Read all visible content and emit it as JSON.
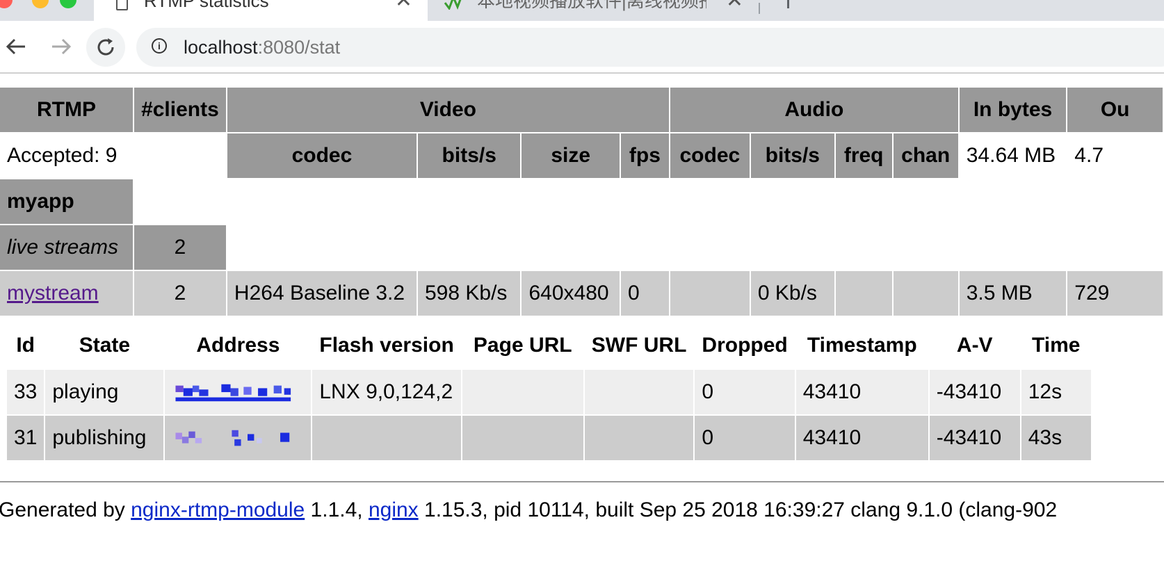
{
  "browser": {
    "active_tab_title": "RTMP statistics",
    "inactive_tab_title": "本地视频播放软件|离线视频播放",
    "url_host": "localhost",
    "url_rest": ":8080/stat"
  },
  "stat_table": {
    "headers": {
      "rtmp": "RTMP",
      "clients": "#clients",
      "video": "Video",
      "audio": "Audio",
      "in_bytes": "In bytes",
      "out_bytes": "Ou"
    },
    "subheaders": {
      "video_codec": "codec",
      "video_bits": "bits/s",
      "video_size": "size",
      "video_fps": "fps",
      "audio_codec": "codec",
      "audio_bits": "bits/s",
      "audio_freq": "freq",
      "audio_chan": "chan"
    },
    "accepted": "Accepted: 9",
    "total_in_bytes": "34.64 MB",
    "total_out_bytes": "4.7",
    "app_name": "myapp",
    "live_streams_label": "live streams",
    "live_streams_count": "2",
    "stream": {
      "name": "mystream",
      "clients": "2",
      "video_codec": "H264 Baseline 3.2",
      "video_bits": "598 Kb/s",
      "video_size": "640x480",
      "video_fps": "0",
      "audio_codec": "",
      "audio_bits": "0 Kb/s",
      "audio_freq": "",
      "audio_chan": "",
      "in_bytes": "3.5 MB",
      "out_bytes": "729"
    }
  },
  "clients_table": {
    "headers": [
      "Id",
      "State",
      "Address",
      "Flash version",
      "Page URL",
      "SWF URL",
      "Dropped",
      "Timestamp",
      "A-V",
      "Time"
    ],
    "rows": [
      {
        "id": "33",
        "state": "playing",
        "flash": "LNX 9,0,124,2",
        "page_url": "",
        "swf_url": "",
        "dropped": "0",
        "timestamp": "43410",
        "av": "-43410",
        "time": "12s"
      },
      {
        "id": "31",
        "state": "publishing",
        "flash": "",
        "page_url": "",
        "swf_url": "",
        "dropped": "0",
        "timestamp": "43410",
        "av": "-43410",
        "time": "43s"
      }
    ]
  },
  "footer": {
    "prefix": "Generated by ",
    "module_link": "nginx-rtmp-module",
    "version_text": " 1.1.4, ",
    "nginx_link": "nginx",
    "rest": " 1.15.3, pid 10114, built Sep 25 2018 16:39:27 clang 9.1.0 (clang-902"
  }
}
